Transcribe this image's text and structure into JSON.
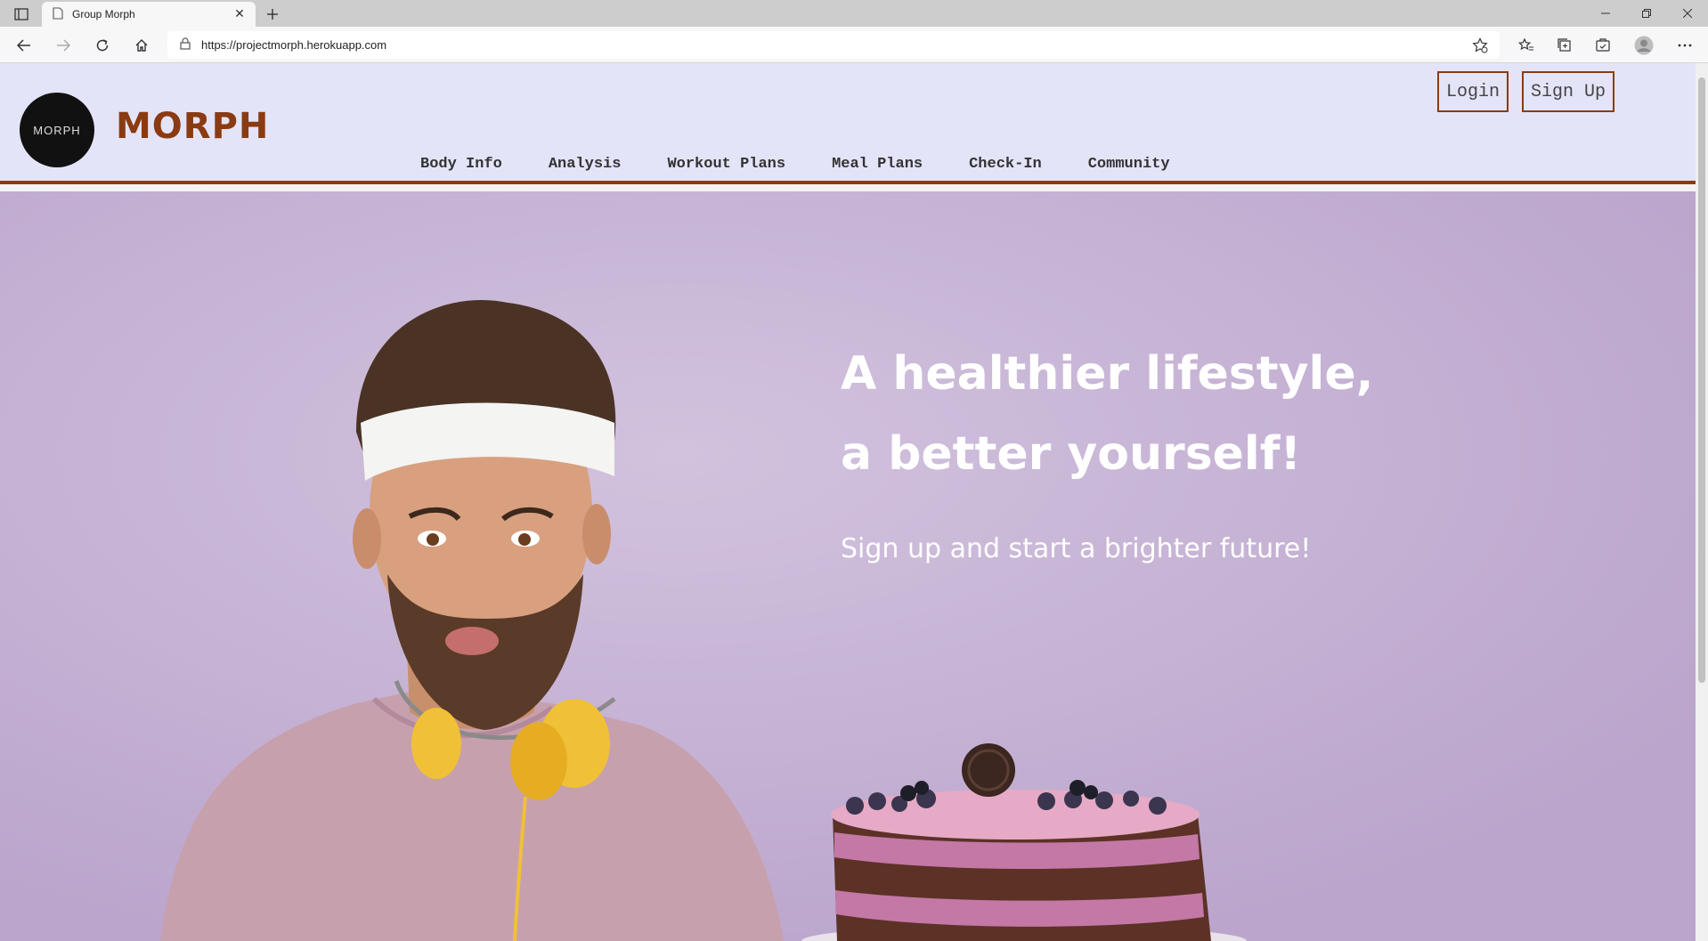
{
  "browser": {
    "tab_title": "Group Morph",
    "url": "https://projectmorph.herokuapp.com"
  },
  "site": {
    "logo_text": "MORPH",
    "brand": "MORPH",
    "login_label": "Login",
    "signup_label": "Sign Up",
    "nav": [
      "Body Info",
      "Analysis",
      "Workout Plans",
      "Meal Plans",
      "Check-In",
      "Community"
    ]
  },
  "hero": {
    "headline_line1": "A healthier lifestyle,",
    "headline_line2": "a better yourself!",
    "subline": "Sign up and start a brighter future!"
  },
  "colors": {
    "accent": "#8a3b12",
    "header_bg": "#e4e4f9",
    "hero_bg": "#c9b6d6"
  }
}
